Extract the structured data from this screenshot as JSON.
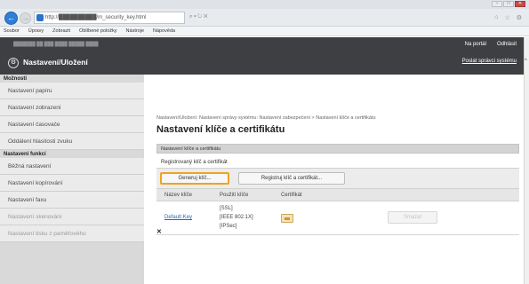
{
  "browser": {
    "url": "http://██████████/m_security_key.html",
    "url_tools": "⌕ ▾ ↻ ✕",
    "right_tools": [
      "⌂",
      "☆",
      "⚙"
    ],
    "window_controls": [
      "–",
      "□",
      "✕"
    ]
  },
  "menu": [
    "Soubor",
    "Úpravy",
    "Zobrazit",
    "Oblíbené položky",
    "Nástroje",
    "Nápověda"
  ],
  "header": {
    "top_text": "███████ ██ ███ ████ █████ ████",
    "icon": "⚙",
    "title": "Nastavení/Uložení",
    "link_portal": "Na portál",
    "link_logout": "Odhlásit",
    "link_admin": "Poslat správci systému"
  },
  "sidebar": {
    "cat_options": "Možnosti",
    "options_items": [
      "Nastavení papíru",
      "Nastavení zobrazení",
      "Nastavení časovače",
      "Oddálení hlasitosti zvuku"
    ],
    "cat_functions": "Nastavení funkcí",
    "function_items": [
      "Běžná nastavení",
      "Nastavení kopírování",
      "Nastavení faxu",
      "Nastavení skenování",
      "Nastavení tisku z paměťového"
    ]
  },
  "content": {
    "breadcrumb": "Nastavení/Uložení: Nastavení správy systému: Nastavení zabezpečení > Nastavení klíče a certifikátu",
    "page_title": "Nastavení klíče a certifikátu",
    "section_title": "Nastavení klíče a certifikátu",
    "sub_label": "Registrovaný klíč a certifikát",
    "btn_generate": "Generuj klíč...",
    "btn_register": "Registruj klíč a certifikát...",
    "columns": [
      "Název klíče",
      "Použití klíče",
      "Certifikát"
    ],
    "row": {
      "name": "Default Key",
      "usage": [
        "[SSL]",
        "[IEEE 802.1X]",
        "[IPSec]"
      ],
      "delete": "Smazat"
    },
    "footer_mark": "✕"
  }
}
